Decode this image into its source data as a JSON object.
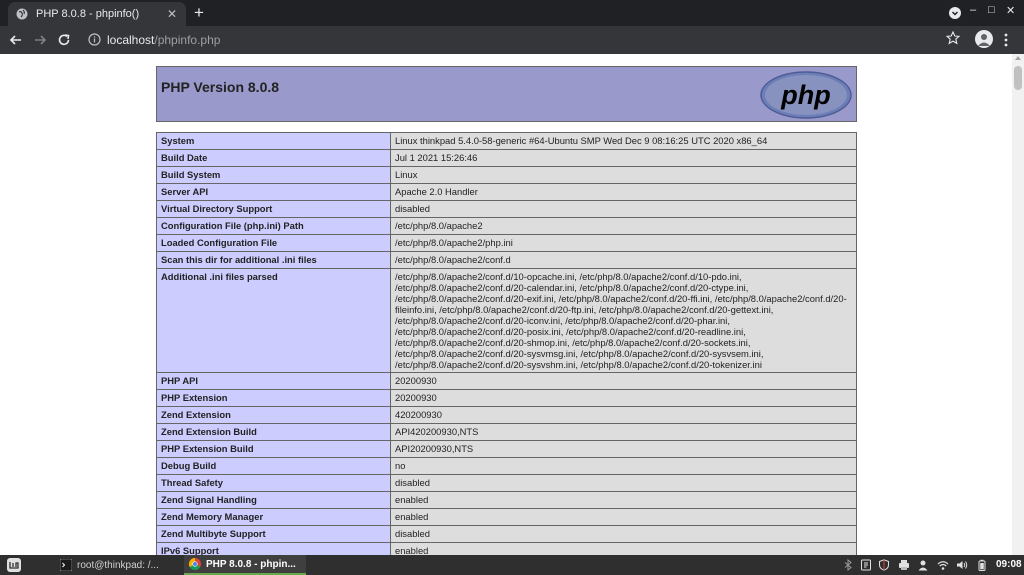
{
  "browser": {
    "tab_title": "PHP 8.0.8 - phpinfo()",
    "tab_close": "✕",
    "new_tab": "+",
    "win_minimize": "–",
    "win_maximize": "□",
    "win_close": "✕",
    "url_host": "localhost",
    "url_path": "/phpinfo.php"
  },
  "page": {
    "title": "PHP Version 8.0.8",
    "logo_text": "php",
    "rows": [
      {
        "key": "System",
        "value": "Linux thinkpad 5.4.0-58-generic #64-Ubuntu SMP Wed Dec 9 08:16:25 UTC 2020 x86_64"
      },
      {
        "key": "Build Date",
        "value": "Jul 1 2021 15:26:46"
      },
      {
        "key": "Build System",
        "value": "Linux"
      },
      {
        "key": "Server API",
        "value": "Apache 2.0 Handler"
      },
      {
        "key": "Virtual Directory Support",
        "value": "disabled"
      },
      {
        "key": "Configuration File (php.ini) Path",
        "value": "/etc/php/8.0/apache2"
      },
      {
        "key": "Loaded Configuration File",
        "value": "/etc/php/8.0/apache2/php.ini"
      },
      {
        "key": "Scan this dir for additional .ini files",
        "value": "/etc/php/8.0/apache2/conf.d"
      },
      {
        "key": "Additional .ini files parsed",
        "value": "/etc/php/8.0/apache2/conf.d/10-opcache.ini, /etc/php/8.0/apache2/conf.d/10-pdo.ini, /etc/php/8.0/apache2/conf.d/20-calendar.ini, /etc/php/8.0/apache2/conf.d/20-ctype.ini, /etc/php/8.0/apache2/conf.d/20-exif.ini, /etc/php/8.0/apache2/conf.d/20-ffi.ini, /etc/php/8.0/apache2/conf.d/20-fileinfo.ini, /etc/php/8.0/apache2/conf.d/20-ftp.ini, /etc/php/8.0/apache2/conf.d/20-gettext.ini, /etc/php/8.0/apache2/conf.d/20-iconv.ini, /etc/php/8.0/apache2/conf.d/20-phar.ini, /etc/php/8.0/apache2/conf.d/20-posix.ini, /etc/php/8.0/apache2/conf.d/20-readline.ini, /etc/php/8.0/apache2/conf.d/20-shmop.ini, /etc/php/8.0/apache2/conf.d/20-sockets.ini, /etc/php/8.0/apache2/conf.d/20-sysvmsg.ini, /etc/php/8.0/apache2/conf.d/20-sysvsem.ini, /etc/php/8.0/apache2/conf.d/20-sysvshm.ini, /etc/php/8.0/apache2/conf.d/20-tokenizer.ini"
      },
      {
        "key": "PHP API",
        "value": "20200930"
      },
      {
        "key": "PHP Extension",
        "value": "20200930"
      },
      {
        "key": "Zend Extension",
        "value": "420200930"
      },
      {
        "key": "Zend Extension Build",
        "value": "API420200930,NTS"
      },
      {
        "key": "PHP Extension Build",
        "value": "API20200930,NTS"
      },
      {
        "key": "Debug Build",
        "value": "no"
      },
      {
        "key": "Thread Safety",
        "value": "disabled"
      },
      {
        "key": "Zend Signal Handling",
        "value": "enabled"
      },
      {
        "key": "Zend Memory Manager",
        "value": "enabled"
      },
      {
        "key": "Zend Multibyte Support",
        "value": "disabled"
      },
      {
        "key": "IPv6 Support",
        "value": "enabled"
      }
    ]
  },
  "taskbar": {
    "terminal_label": "root@thinkpad: /...",
    "browser_label": "PHP 8.0.8 - phpin...",
    "clock": "09:08"
  },
  "colors": {
    "header_bg": "#9999cc",
    "key_bg": "#ccccff",
    "value_bg": "#dddddd",
    "taskbar_accent": "#6aa84f"
  }
}
